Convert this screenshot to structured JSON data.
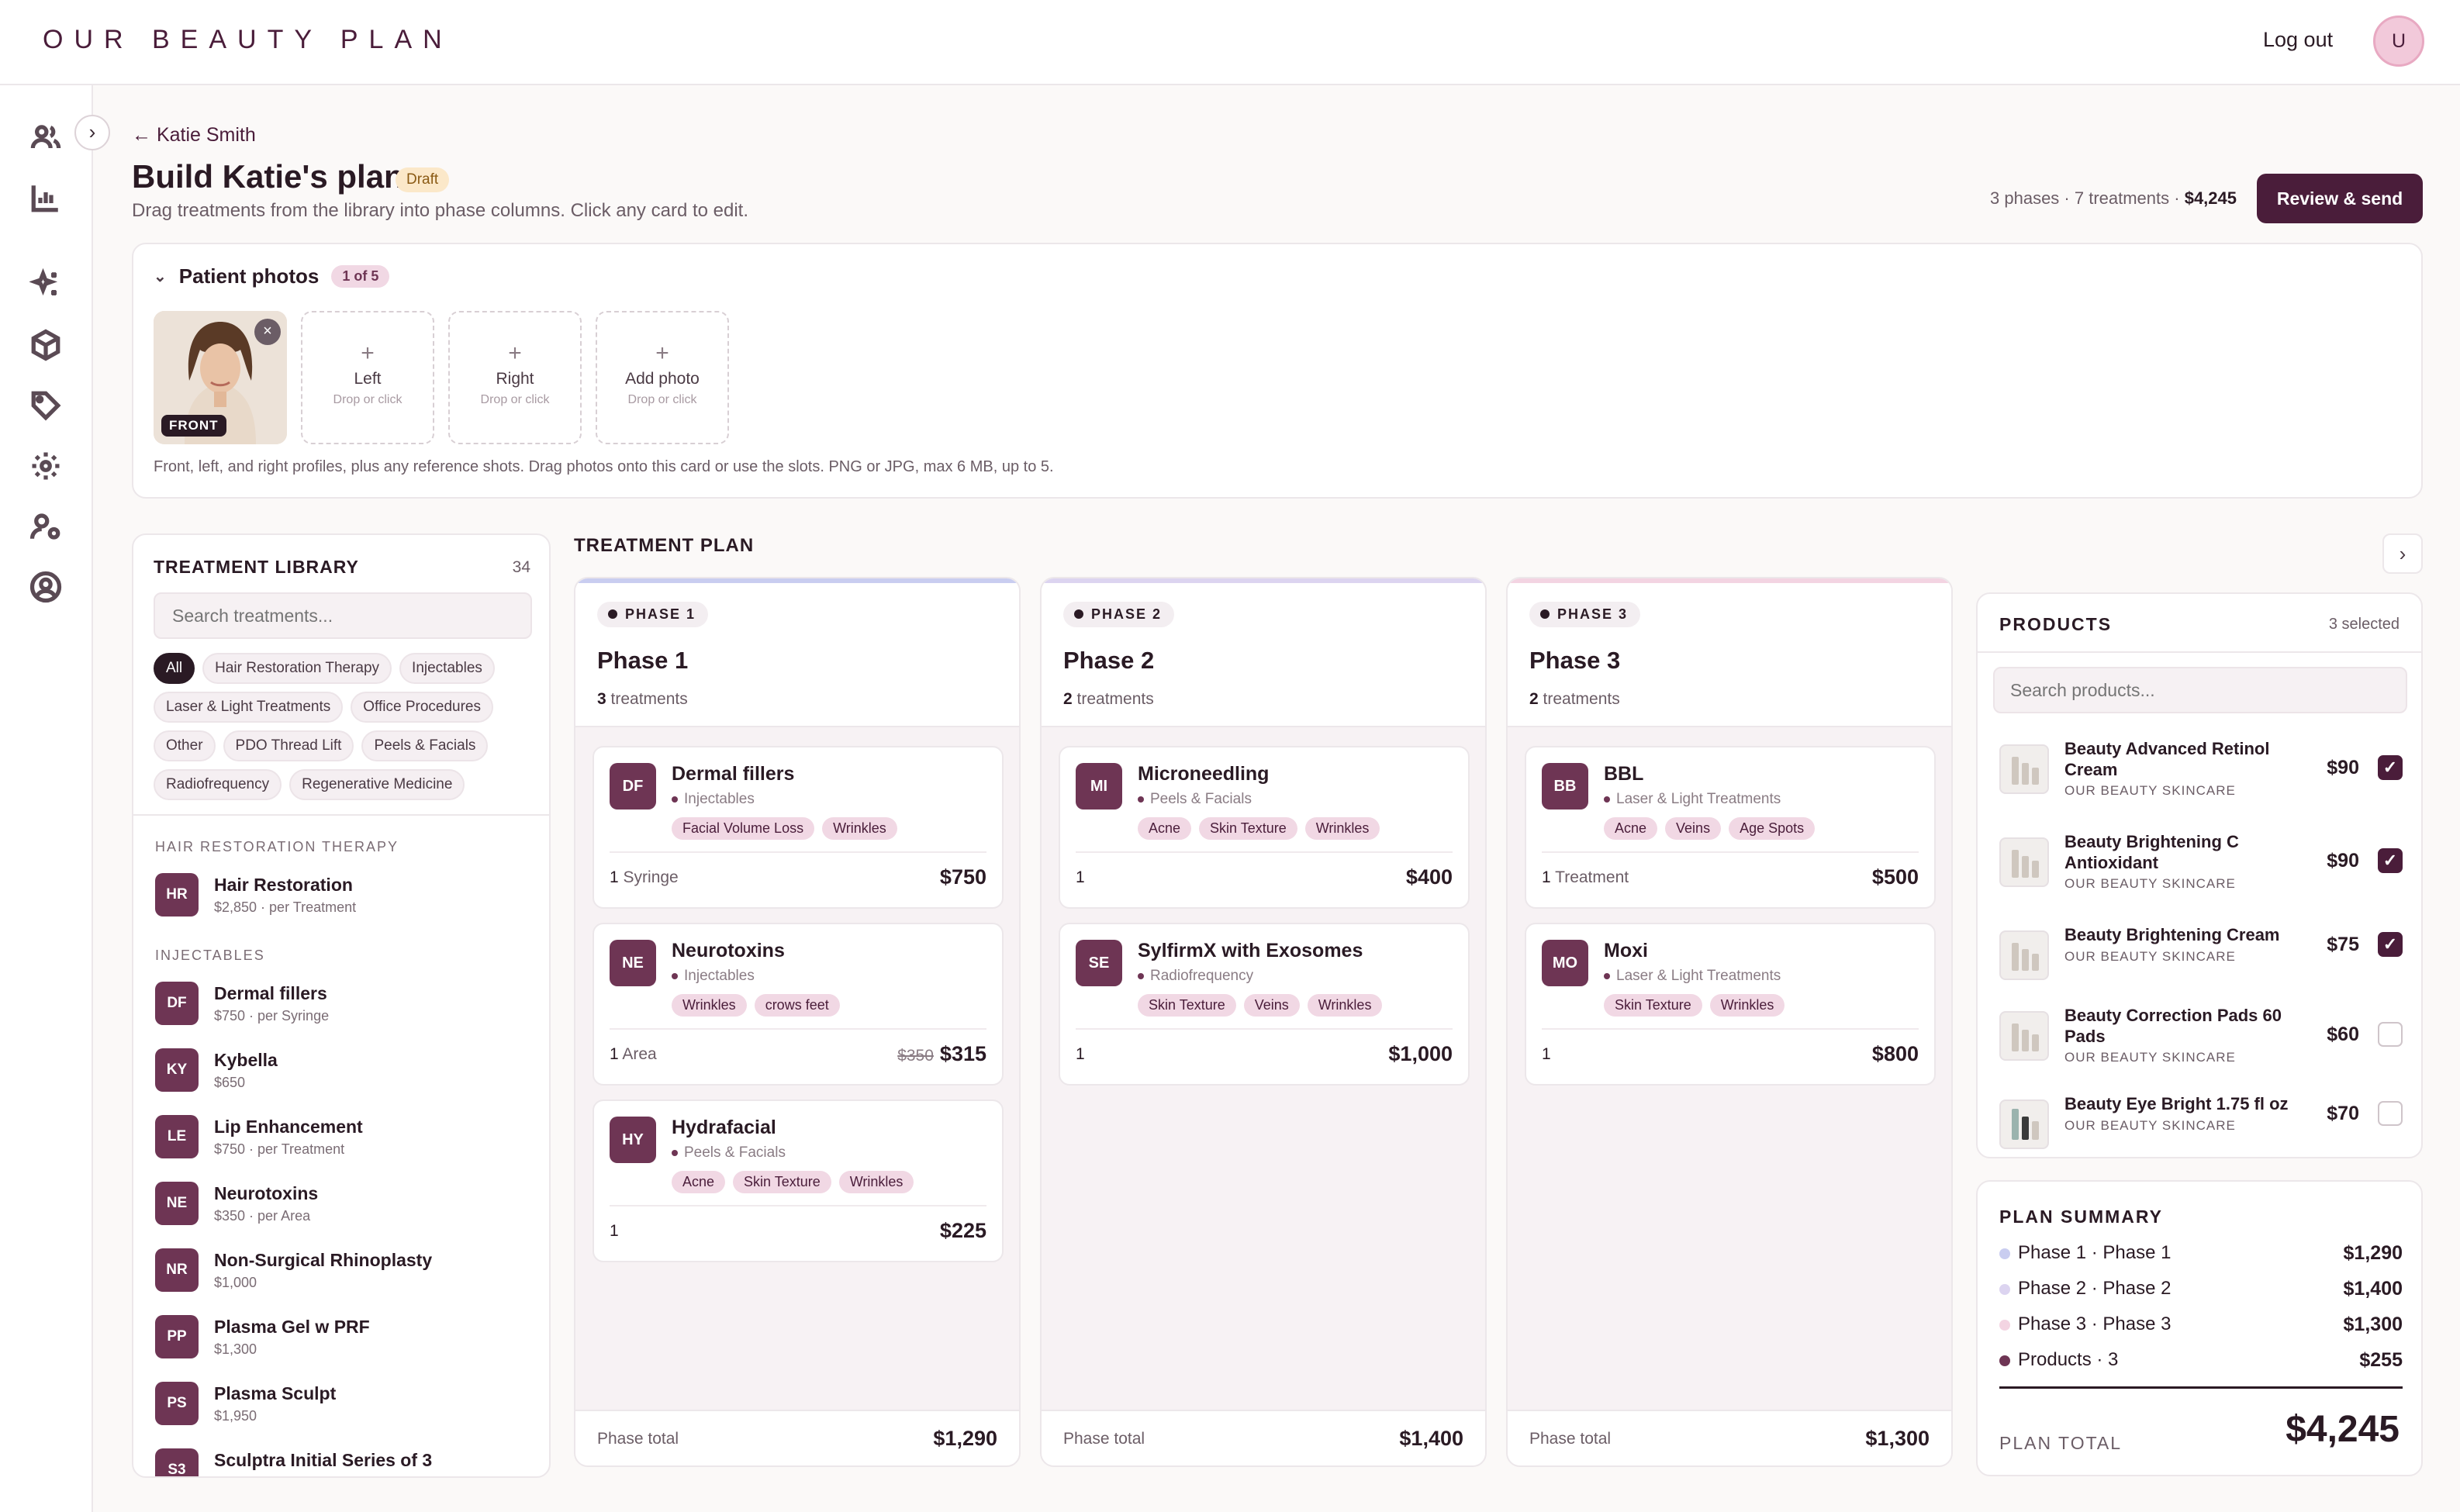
{
  "app": {
    "brand": "OUR BEAUTY PLAN",
    "logout": "Log out",
    "avatar_initial": "U"
  },
  "nav": {
    "icons": [
      "users-icon",
      "bar-chart-icon",
      "sparkle-icon",
      "box-icon",
      "tag-icon",
      "gear-icon",
      "user-settings-icon",
      "user-circle-icon"
    ],
    "toggle": "›"
  },
  "header": {
    "back_label": "← Katie Smith",
    "title": "Build Katie's plan",
    "status": "Draft",
    "subtitle": "Drag treatments from the library into phase columns. Click any card to edit.",
    "summary_prefix": "3 phases · 7 treatments ·",
    "summary_total": "$4,245",
    "review_button": "Review & send"
  },
  "photos": {
    "title": "Patient photos",
    "count": "1 of 5",
    "front_label": "FRONT",
    "remove": "×",
    "slots": [
      {
        "label": "Left",
        "hint": "Drop or click"
      },
      {
        "label": "Right",
        "hint": "Drop or click"
      },
      {
        "label": "Add photo",
        "hint": "Drop or click"
      }
    ],
    "note": "Front, left, and right profiles, plus any reference shots. Drag photos onto this card or use the slots. PNG or JPG, max 6 MB, up to 5."
  },
  "library": {
    "title": "TREATMENT LIBRARY",
    "count": "34",
    "search_placeholder": "Search treatments...",
    "chips": [
      "All",
      "Hair Restoration Therapy",
      "Injectables",
      "Laser & Light Treatments",
      "Office Procedures",
      "Other",
      "PDO Thread Lift",
      "Peels & Facials",
      "Radiofrequency",
      "Regenerative Medicine"
    ],
    "groups": [
      {
        "name": "HAIR RESTORATION THERAPY",
        "items": [
          {
            "abbr": "HR",
            "name": "Hair Restoration",
            "price": "$2,850 · per Treatment"
          }
        ]
      },
      {
        "name": "INJECTABLES",
        "items": [
          {
            "abbr": "DF",
            "name": "Dermal fillers",
            "price": "$750 · per Syringe"
          },
          {
            "abbr": "KY",
            "name": "Kybella",
            "price": "$650"
          },
          {
            "abbr": "LE",
            "name": "Lip Enhancement",
            "price": "$750 · per Treatment"
          },
          {
            "abbr": "NE",
            "name": "Neurotoxins",
            "price": "$350 · per Area"
          },
          {
            "abbr": "NR",
            "name": "Non-Surgical Rhinoplasty",
            "price": "$1,000"
          },
          {
            "abbr": "PP",
            "name": "Plasma Gel w PRF",
            "price": "$1,300"
          },
          {
            "abbr": "PS",
            "name": "Plasma Sculpt",
            "price": "$1,950"
          },
          {
            "abbr": "S3",
            "name": "Sculptra Initial Series of 3",
            "price": ""
          }
        ]
      }
    ]
  },
  "plan": {
    "title": "TREATMENT PLAN",
    "scroll": "›",
    "phases": [
      {
        "tag": "PHASE 1",
        "name": "Phase 1",
        "count": "3",
        "count_label": "treatments",
        "total_label": "Phase total",
        "total": "$1,290",
        "cards": [
          {
            "abbr": "DF",
            "name": "Dermal fillers",
            "category": "Injectables",
            "tags": [
              "Facial Volume Loss",
              "Wrinkles"
            ],
            "qty": "1",
            "unit": "Syringe",
            "old_price": "",
            "price": "$750"
          },
          {
            "abbr": "NE",
            "name": "Neurotoxins",
            "category": "Injectables",
            "tags": [
              "Wrinkles",
              "crows feet"
            ],
            "qty": "1",
            "unit": "Area",
            "old_price": "$350",
            "price": "$315"
          },
          {
            "abbr": "HY",
            "name": "Hydrafacial",
            "category": "Peels & Facials",
            "tags": [
              "Acne",
              "Skin Texture",
              "Wrinkles"
            ],
            "qty": "1",
            "unit": "",
            "old_price": "",
            "price": "$225"
          }
        ]
      },
      {
        "tag": "PHASE 2",
        "name": "Phase 2",
        "count": "2",
        "count_label": "treatments",
        "total_label": "Phase total",
        "total": "$1,400",
        "cards": [
          {
            "abbr": "MI",
            "name": "Microneedling",
            "category": "Peels & Facials",
            "tags": [
              "Acne",
              "Skin Texture",
              "Wrinkles"
            ],
            "qty": "1",
            "unit": "",
            "old_price": "",
            "price": "$400"
          },
          {
            "abbr": "SE",
            "name": "SylfirmX with Exosomes",
            "category": "Radiofrequency",
            "tags": [
              "Skin Texture",
              "Veins",
              "Wrinkles"
            ],
            "qty": "1",
            "unit": "",
            "old_price": "",
            "price": "$1,000"
          }
        ]
      },
      {
        "tag": "PHASE 3",
        "name": "Phase 3",
        "count": "2",
        "count_label": "treatments",
        "total_label": "Phase total",
        "total": "$1,300",
        "cards": [
          {
            "abbr": "BB",
            "name": "BBL",
            "category": "Laser & Light Treatments",
            "tags": [
              "Acne",
              "Veins",
              "Age Spots"
            ],
            "qty": "1",
            "unit": "Treatment",
            "old_price": "",
            "price": "$500"
          },
          {
            "abbr": "MO",
            "name": "Moxi",
            "category": "Laser & Light Treatments",
            "tags": [
              "Skin Texture",
              "Wrinkles"
            ],
            "qty": "1",
            "unit": "",
            "old_price": "",
            "price": "$800"
          }
        ]
      }
    ]
  },
  "products": {
    "title": "PRODUCTS",
    "count": "3 selected",
    "search_placeholder": "Search products...",
    "items": [
      {
        "name": "Beauty Advanced Retinol Cream",
        "brand": "OUR BEAUTY SKINCARE",
        "price": "$90",
        "checked": true
      },
      {
        "name": "Beauty Brightening C Antioxidant",
        "brand": "OUR BEAUTY SKINCARE",
        "price": "$90",
        "checked": true
      },
      {
        "name": "Beauty Brightening Cream",
        "brand": "OUR BEAUTY SKINCARE",
        "price": "$75",
        "checked": true
      },
      {
        "name": "Beauty Correction Pads 60 Pads",
        "brand": "OUR BEAUTY SKINCARE",
        "price": "$60",
        "checked": false
      },
      {
        "name": "Beauty Eye Bright 1.75 fl oz",
        "brand": "OUR BEAUTY SKINCARE",
        "price": "$70",
        "checked": false
      }
    ]
  },
  "summary": {
    "title": "PLAN SUMMARY",
    "rows": [
      {
        "label": "Phase 1 · Phase 1",
        "value": "$1,290",
        "color": "#c9cdf0"
      },
      {
        "label": "Phase 2 · Phase 2",
        "value": "$1,400",
        "color": "#dcd4f0"
      },
      {
        "label": "Phase 3 · Phase 3",
        "value": "$1,300",
        "color": "#f3d4e2"
      },
      {
        "label": "Products · 3",
        "value": "$255",
        "color": "#6e3554"
      }
    ],
    "total_label": "PLAN TOTAL",
    "total": "$4,245"
  },
  "colors": {
    "brand": "#4a1d3a",
    "accent": "#6e3554",
    "tag_bg": "#f1d8e4",
    "draft_bg": "#fbe8c9",
    "phase_bars": [
      "#c9cdf0",
      "#dcd4f0",
      "#f3d4e2"
    ]
  }
}
